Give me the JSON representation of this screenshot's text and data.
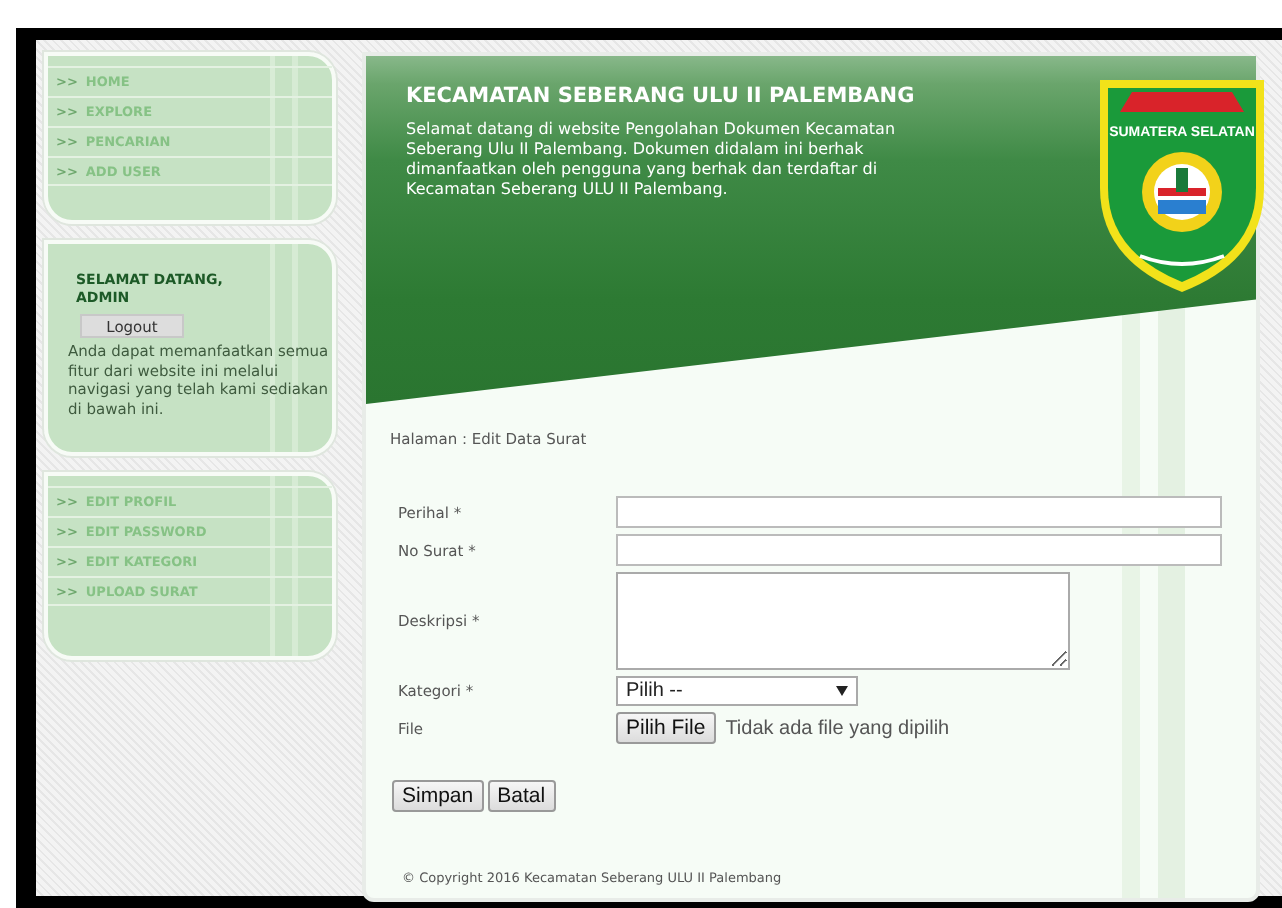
{
  "sidebar": {
    "menu_top": [
      {
        "marker": ">>",
        "label": "HOME"
      },
      {
        "marker": ">>",
        "label": "EXPLORE"
      },
      {
        "marker": ">>",
        "label": "PENCARIAN"
      },
      {
        "marker": ">>",
        "label": "ADD USER"
      }
    ],
    "welcome": {
      "title_lines": [
        "SELAMAT DATANG,",
        "ADMIN"
      ],
      "logout": "Logout",
      "text": "Anda dapat memanfaatkan semua fitur dari website ini melalui navigasi yang telah kami sediakan di bawah ini."
    },
    "menu_bottom": [
      {
        "marker": ">>",
        "label": "EDIT PROFIL"
      },
      {
        "marker": ">>",
        "label": "EDIT PASSWORD"
      },
      {
        "marker": ">>",
        "label": "EDIT KATEGORI"
      },
      {
        "marker": ">>",
        "label": "UPLOAD SURAT"
      }
    ]
  },
  "header": {
    "title": "KECAMATAN SEBERANG ULU II PALEMBANG",
    "intro": "Selamat datang di website Pengolahan Dokumen Kecamatan Seberang Ulu II Palembang. Dokumen didalam ini berhak dimanfaatkan oleh pengguna yang berhak dan terdaftar di Kecamatan Seberang ULU II Palembang.",
    "logo_text": "SUMATERA SELATAN"
  },
  "breadcrumb": "Halaman : Edit Data Surat",
  "form": {
    "fields": [
      {
        "kind": "text",
        "label": "Perihal *"
      },
      {
        "kind": "text",
        "label": "No Surat *"
      },
      {
        "kind": "textarea",
        "label": "Deskripsi *"
      },
      {
        "kind": "select",
        "label": "Kategori *",
        "value": "Pilih --"
      },
      {
        "kind": "file",
        "label": "File",
        "button": "Pilih File",
        "status": "Tidak ada file yang dipilih"
      }
    ],
    "buttons": [
      "Simpan",
      "Batal"
    ]
  },
  "footer": "© Copyright 2016 Kecamatan Seberang ULU II Palembang"
}
